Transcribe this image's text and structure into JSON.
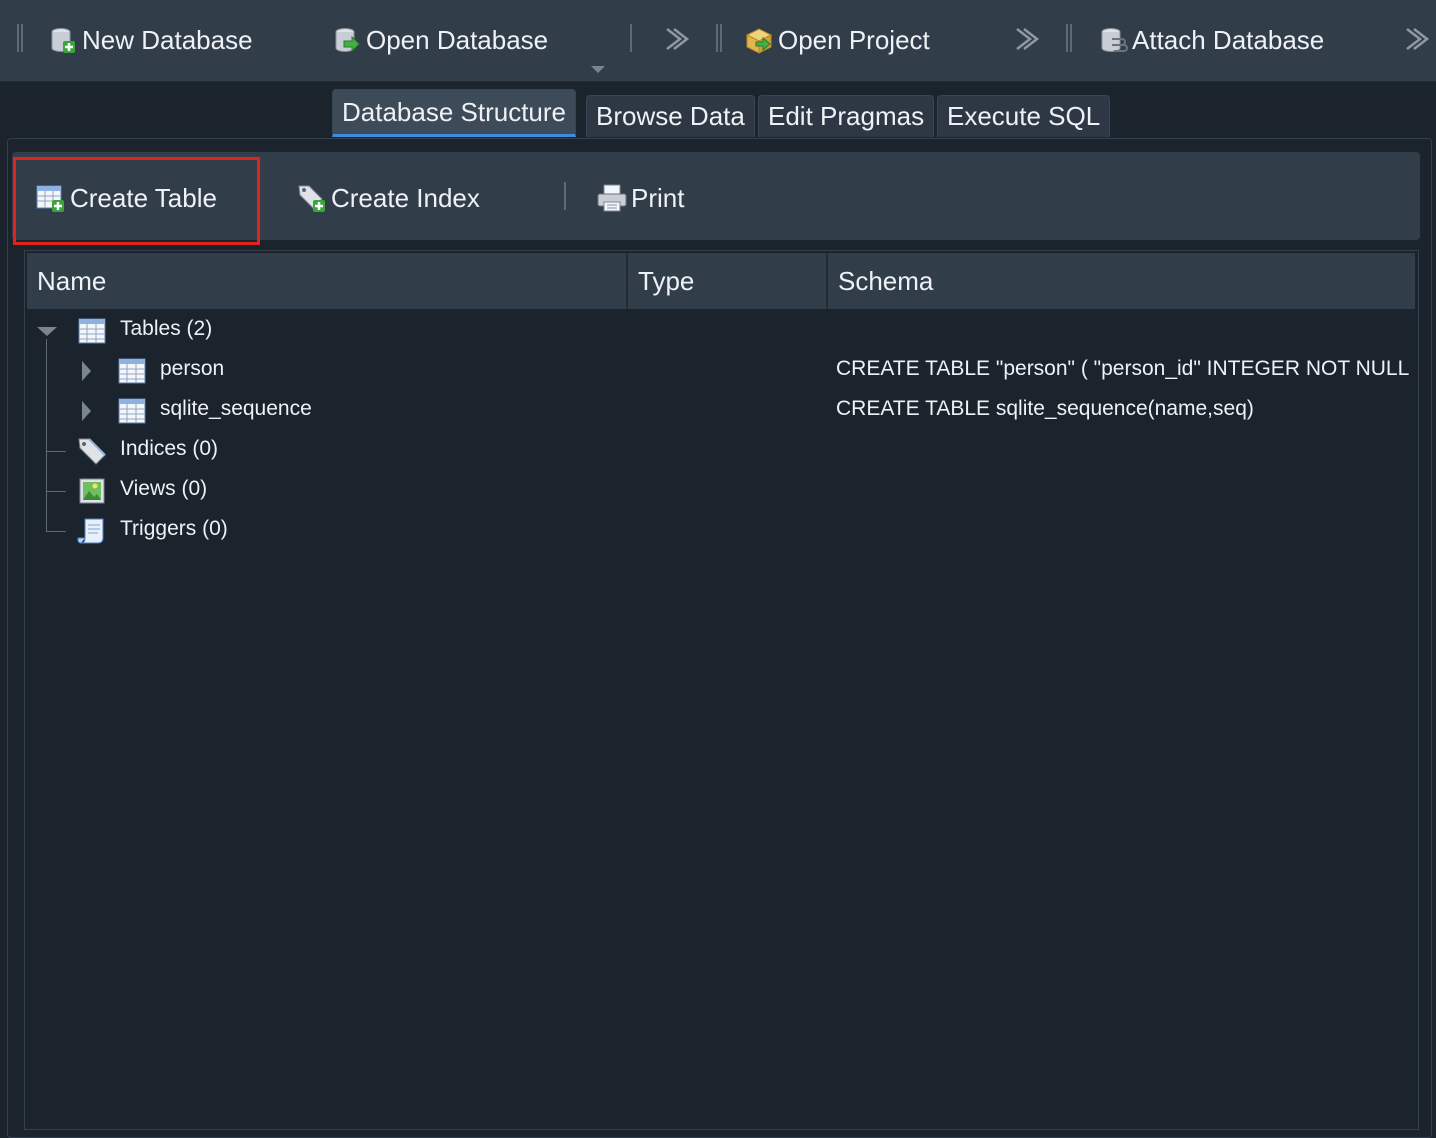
{
  "toolbar": {
    "new_database": "New Database",
    "open_database": "Open Database",
    "open_project": "Open Project",
    "attach_database": "Attach Database"
  },
  "tabs": [
    {
      "label": "Database Structure",
      "active": true
    },
    {
      "label": "Browse Data",
      "active": false
    },
    {
      "label": "Edit Pragmas",
      "active": false
    },
    {
      "label": "Execute SQL",
      "active": false
    }
  ],
  "structure_toolbar": {
    "create_table": "Create Table",
    "create_index": "Create Index",
    "print": "Print"
  },
  "tree": {
    "columns": [
      "Name",
      "Type",
      "Schema"
    ],
    "rows": [
      {
        "name": "Tables (2)",
        "type": "",
        "schema": ""
      },
      {
        "name": "person",
        "type": "",
        "schema": "CREATE TABLE \"person\" ( \"person_id\" INTEGER NOT NULL UNIQUE, \"name\" TEXT, PRIMARY KEY(\"person_id\" AUTOINCREMENT) )"
      },
      {
        "name": "sqlite_sequence",
        "type": "",
        "schema": "CREATE TABLE sqlite_sequence(name,seq)"
      },
      {
        "name": "Indices (0)",
        "type": "",
        "schema": ""
      },
      {
        "name": "Views (0)",
        "type": "",
        "schema": ""
      },
      {
        "name": "Triggers (0)",
        "type": "",
        "schema": ""
      }
    ]
  },
  "colors": {
    "highlight": "#e0231d",
    "active_tab_underline": "#3c8ce0"
  }
}
